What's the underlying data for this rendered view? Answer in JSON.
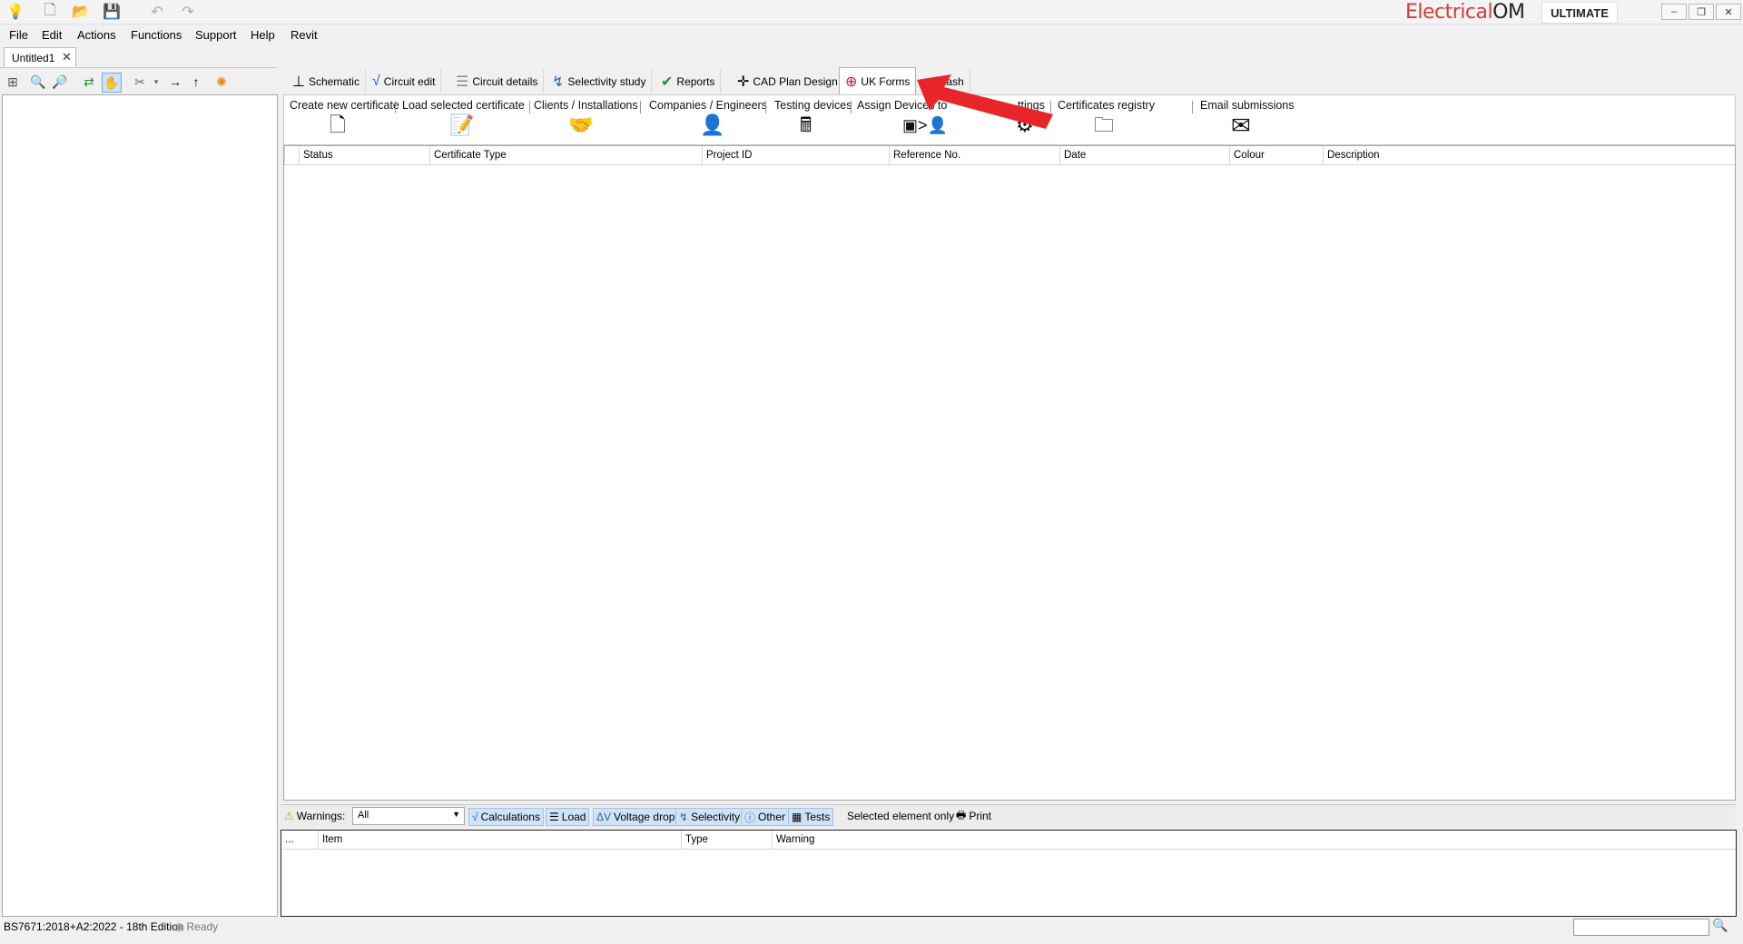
{
  "titlebar": {
    "brand_left": "Electrical",
    "brand_right": "OM",
    "edition": "ULTIMATE",
    "icons": [
      "app-logo-icon",
      "new-file-icon",
      "open-folder-icon",
      "save-icon",
      "undo-icon",
      "redo-icon"
    ],
    "window_buttons": [
      "–",
      "❐",
      "✕"
    ]
  },
  "menu": [
    "File",
    "Edit",
    "Actions",
    "Functions",
    "Support",
    "Help",
    "Revit"
  ],
  "doc_tab": {
    "title": "Untitled1",
    "close": "✕"
  },
  "main_tabs": [
    {
      "label": "Schematic",
      "icon": "schematic-icon"
    },
    {
      "label": "Circuit edit",
      "icon": "circuit-edit-icon"
    },
    {
      "label": "Circuit details",
      "icon": "circuit-details-icon"
    },
    {
      "label": "Selectivity study",
      "icon": "selectivity-icon"
    },
    {
      "label": "Reports",
      "icon": "reports-icon"
    },
    {
      "label": "CAD Plan Design",
      "icon": "cad-icon"
    },
    {
      "label": "UK Forms",
      "icon": "uk-flag-icon"
    },
    {
      "label": "ash",
      "icon": "star-icon"
    }
  ],
  "ribbon": [
    {
      "label": "Create new certificate",
      "glyph": "🗋"
    },
    {
      "label": "Load selected certificate",
      "glyph": "📝"
    },
    {
      "label": "Clients / Installations",
      "glyph": "🤝"
    },
    {
      "label": "Companies / Engineers",
      "glyph": "👤"
    },
    {
      "label": "Testing devices",
      "glyph": "🖩"
    },
    {
      "label": "Assign Devices to",
      "glyph": "▣>👤"
    },
    {
      "label": "ttings",
      "glyph": "⚙"
    },
    {
      "label": "Certificates registry",
      "glyph": "🗀"
    },
    {
      "label": "Email submissions",
      "glyph": "✉"
    }
  ],
  "grid": {
    "columns": [
      "Status",
      "Certificate Type",
      "Project ID",
      "Reference No.",
      "Date",
      "Colour",
      "Description"
    ]
  },
  "warnings": {
    "label": "Warnings:",
    "filter_value": "All",
    "toggles": [
      "Calculations",
      "Load",
      "Voltage drop",
      "Selectivity",
      "Other",
      "Tests"
    ],
    "selected_only": "Selected element only",
    "print": "Print",
    "columns": [
      "...",
      "Item",
      "Type",
      "Warning"
    ]
  },
  "status": {
    "standard": "BS7671:2018+A2:2022 - 18th Edition",
    "state": "Ready"
  },
  "colors": {
    "brand_red": "#d83a3a",
    "arrow_red": "#e8262a",
    "toggle_bg": "#cfe3f7"
  }
}
